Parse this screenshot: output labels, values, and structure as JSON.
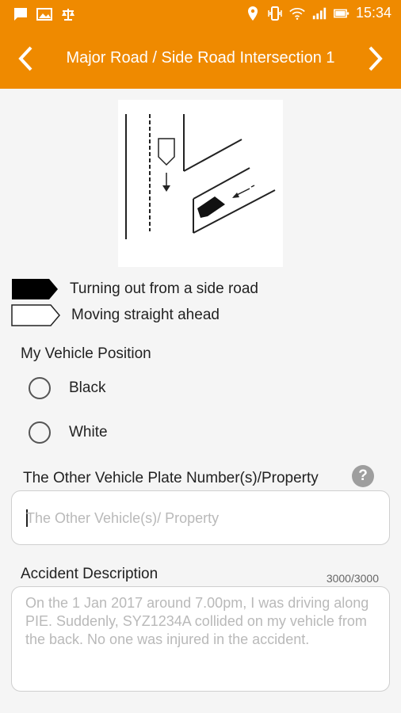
{
  "status_bar": {
    "time": "15:34",
    "icons_left": [
      "message-icon",
      "image-icon",
      "scale-icon"
    ],
    "icons_right": [
      "location-icon",
      "vibrate-icon",
      "wifi-icon",
      "signal-icon",
      "battery-icon"
    ]
  },
  "header": {
    "title": "Major Road / Side Road Intersection 1",
    "prev_icon": "chevron-left-icon",
    "next_icon": "chevron-right-icon",
    "color": "#ef8a00"
  },
  "legend": [
    {
      "label": "Turning out from a side road",
      "swatch": "black"
    },
    {
      "label": "Moving straight ahead",
      "swatch": "white"
    }
  ],
  "vehicle_position": {
    "label": "My Vehicle Position",
    "options": [
      {
        "label": "Black",
        "selected": false
      },
      {
        "label": "White",
        "selected": false
      }
    ]
  },
  "other_vehicle": {
    "label": "The Other Vehicle Plate Number(s)/Property",
    "placeholder": "The Other Vehicle(s)/ Property",
    "value": ""
  },
  "accident_description": {
    "label": "Accident Description",
    "counter": "3000/3000",
    "placeholder": "On the 1 Jan 2017 around 7.00pm, I was driving along PIE. Suddenly, SYZ1234A collided on my vehicle from the back. No one was injured in the accident.",
    "value": ""
  }
}
